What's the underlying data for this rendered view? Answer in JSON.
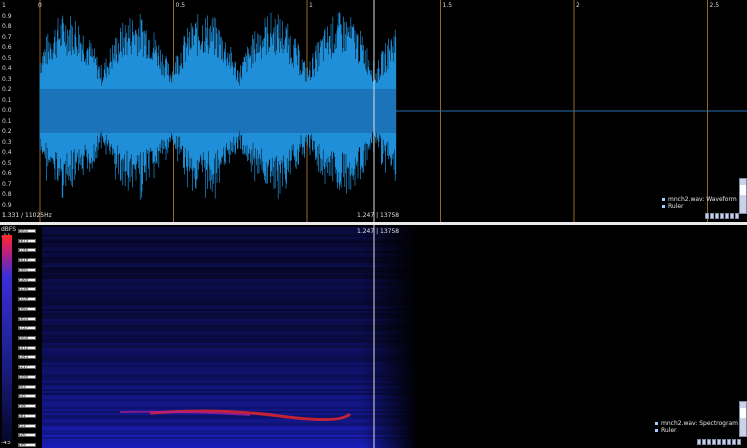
{
  "waveform": {
    "y_labels": [
      "1",
      "0.9",
      "0.8",
      "0.7",
      "0.6",
      "0.5",
      "0.4",
      "0.3",
      "0.2",
      "0.1",
      "0.0",
      "0.1",
      "0.2",
      "0.3",
      "0.4",
      "0.5",
      "0.6",
      "0.7",
      "0.8",
      "0.9",
      "1"
    ],
    "x_labels": [
      "0.5",
      "1",
      "1.5",
      "2",
      "2.5"
    ],
    "x_start_label": "0",
    "footer_left": "1.331 / 11025Hz",
    "cursor_readout": "1.247 | 13758",
    "legend_items": [
      "mnch2.wav: Waveform",
      "Ruler"
    ],
    "colors": {
      "wave": "#1e8fd8",
      "wave_core": "#1a5fa0",
      "grid": "#c98a2a",
      "zero_line": "#2a6fb5",
      "cursor": "#dcdcdc"
    }
  },
  "spectrogram": {
    "db_unit": "dBFS",
    "db_top": "-11",
    "db_bottom": "-45",
    "cursor_readout": "1.247 | 13758",
    "freq_labels": [
      "3001",
      "2873",
      "2746",
      "2619",
      "2491",
      "2364",
      "2236",
      "2109",
      "1982",
      "1854",
      "1727",
      "1600",
      "1472",
      "1345",
      "1217",
      "1090",
      "963",
      "835",
      "708",
      "581",
      "453",
      "326",
      "199"
    ],
    "legend_items": [
      "mnch2.wav: Spectrogram",
      "Ruler"
    ],
    "colors": {
      "bg": "#000000",
      "band": "#1b1f9e",
      "hot": "#d8242c"
    }
  }
}
